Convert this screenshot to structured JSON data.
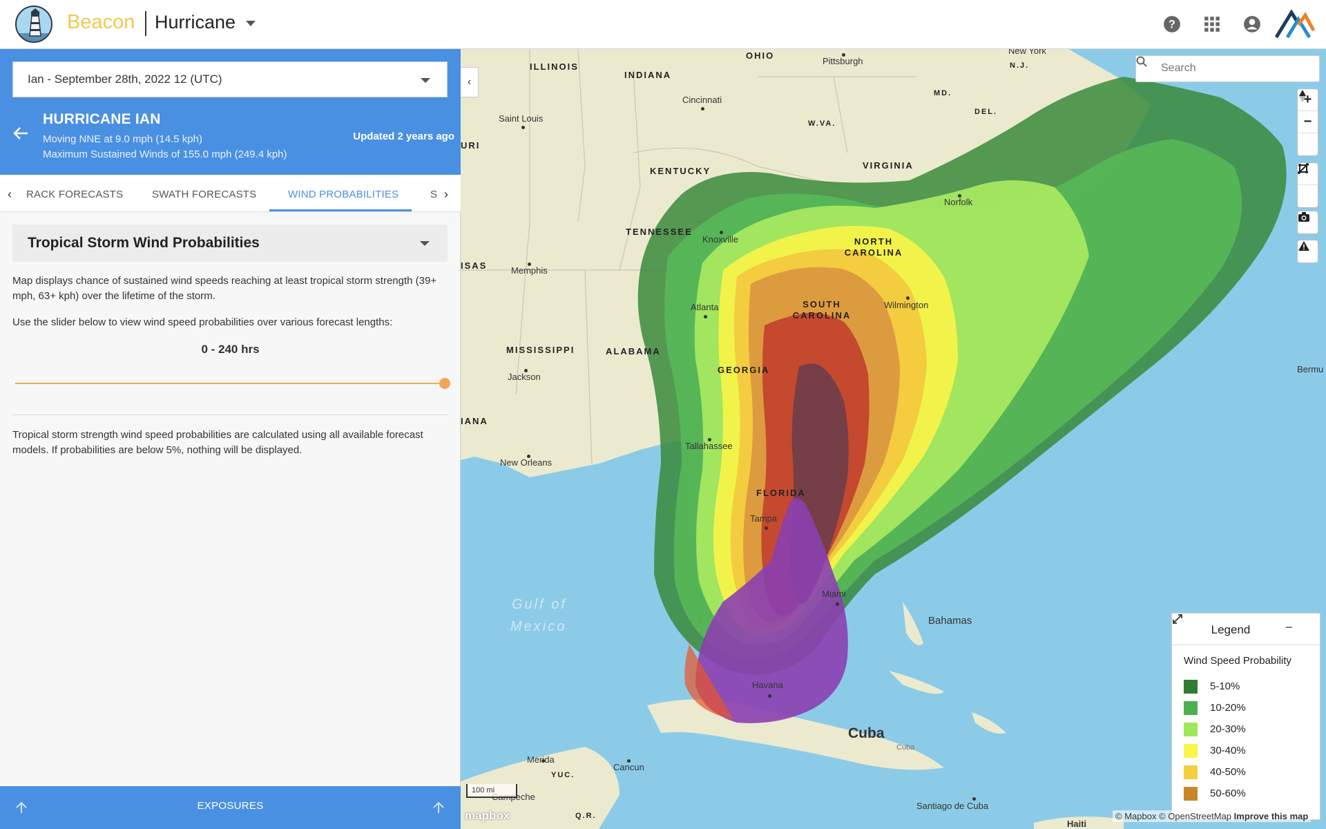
{
  "header": {
    "brand": "Beacon",
    "module": "Hurricane",
    "icons": [
      "help-icon",
      "apps-grid-icon",
      "account-icon"
    ]
  },
  "panel": {
    "storm_selector": "Ian - September 28th, 2022 12 (UTC)",
    "storm": {
      "title": "HURRICANE IAN",
      "movement": "Moving NNE at 9.0 mph (14.5 kph)",
      "winds": "Maximum Sustained Winds of 155.0 mph (249.4 kph)",
      "updated": "Updated 2 years ago"
    },
    "tabs": [
      "RACK FORECASTS",
      "SWATH FORECASTS",
      "WIND PROBABILITIES",
      "S"
    ],
    "active_tab": "WIND PROBABILITIES",
    "probability_type": "Tropical Storm Wind Probabilities",
    "description": "Map displays chance of sustained wind speeds reaching at least tropical storm strength (39+ mph, 63+ kph) over the lifetime of the storm.",
    "slider_instruction": "Use the slider below to view wind speed probabilities over various forecast lengths:",
    "range_label": "0 - 240 hrs",
    "slider_value_fraction": 1.0,
    "note": "Tropical storm strength wind speed probabilities are calculated using all available forecast models. If probabilities are below 5%, nothing will be displayed.",
    "exposures_label": "EXPOSURES"
  },
  "map": {
    "search_placeholder": "Search",
    "states": [
      "ILLINOIS",
      "INDIANA",
      "OHIO",
      "KENTUCKY",
      "VIRGINIA",
      "W.VA.",
      "MD.",
      "DEL.",
      "N.J.",
      "TENNESSEE",
      "NORTH CAROLINA",
      "SOUTH CAROLINA",
      "GEORGIA",
      "ALABAMA",
      "MISSISSIPPI",
      "FLORIDA",
      "URI",
      "ISAS",
      "IANA",
      "YUC.",
      "Q.R."
    ],
    "cities": [
      "Pittsburgh",
      "New York",
      "Cincinnati",
      "Saint Louis",
      "Norfolk",
      "Knoxville",
      "Memphis",
      "Atlanta",
      "Wilmington",
      "Jackson",
      "Tallahassee",
      "New Orleans",
      "Tampa",
      "Miami",
      "Havana",
      "Merida",
      "Cancun",
      "Santiago de Cuba",
      "Campeche"
    ],
    "water_labels": [
      "Gulf of",
      "Mexico"
    ],
    "other_labels": [
      "Bahamas",
      "Cuba",
      "Cuba",
      "Bermu",
      "Haiti"
    ],
    "controls": [
      "zoom-in-icon",
      "zoom-out-icon",
      "compass-icon",
      "draw-line-icon",
      "draw-polygon-icon",
      "camera-icon",
      "warning-icon"
    ],
    "legend": {
      "title": "Legend",
      "subtitle": "Wind Speed Probability",
      "items": [
        {
          "label": "5-10%",
          "color": "#2e7d32"
        },
        {
          "label": "10-20%",
          "color": "#4caf50"
        },
        {
          "label": "20-30%",
          "color": "#9ee85a"
        },
        {
          "label": "30-40%",
          "color": "#f7f74a"
        },
        {
          "label": "40-50%",
          "color": "#f2cf3e"
        },
        {
          "label": "50-60%",
          "color": "#c8862a"
        }
      ]
    },
    "attribution": {
      "text": "© Mapbox © OpenStreetMap",
      "link": "Improve this map"
    },
    "scale_label": "100 mi",
    "mapbox_logo": "mapbox"
  }
}
